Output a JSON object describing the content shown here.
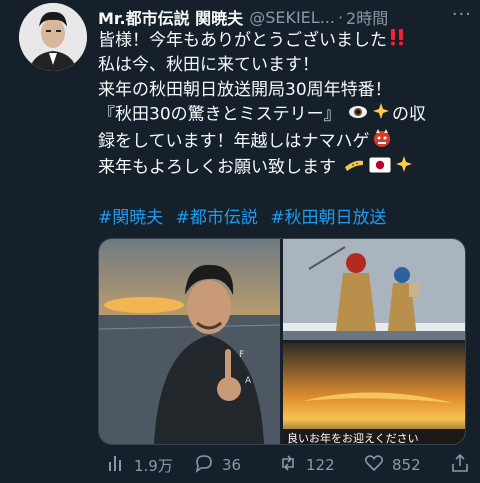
{
  "tweet": {
    "display_name": "Mr.都市伝説 関暁夫",
    "handle": "@SEKIEL...",
    "separator": "·",
    "time": "2時間",
    "more_label": "···",
    "lines": [
      "皆様！今年もありがとうございました",
      "私は今、秋田に来ています！",
      "来年の秋田朝日放送開局30周年特番！",
      "『秋田30の驚きとミステリー』",
      "の収",
      "録をしています！年越しはナマハゲ",
      "来年もよろしくお願い致します"
    ],
    "hashtags": [
      "#関暁夫",
      "#都市伝説",
      "#秋田朝日放送"
    ],
    "media": {
      "caption_c": "良いお年をお迎えください"
    },
    "actions": {
      "views": "1.9万",
      "replies": "36",
      "retweets": "122",
      "likes": "852"
    }
  },
  "icons": {
    "views": "bar-chart-icon",
    "reply": "reply-bubble-icon",
    "retweet": "retweet-icon",
    "like": "heart-icon",
    "share": "share-icon",
    "emoji": [
      "double-exclamation-icon",
      "eye-icon",
      "sparkles-icon",
      "ogre-mask-icon",
      "flute-icon",
      "japan-flag-icon",
      "sparkles-icon"
    ]
  },
  "colors": {
    "background": "#15202b",
    "text": "#f7f9f9",
    "secondary": "#8b98a5",
    "link": "#1d9bf0",
    "accent_red": "#f4212e"
  }
}
